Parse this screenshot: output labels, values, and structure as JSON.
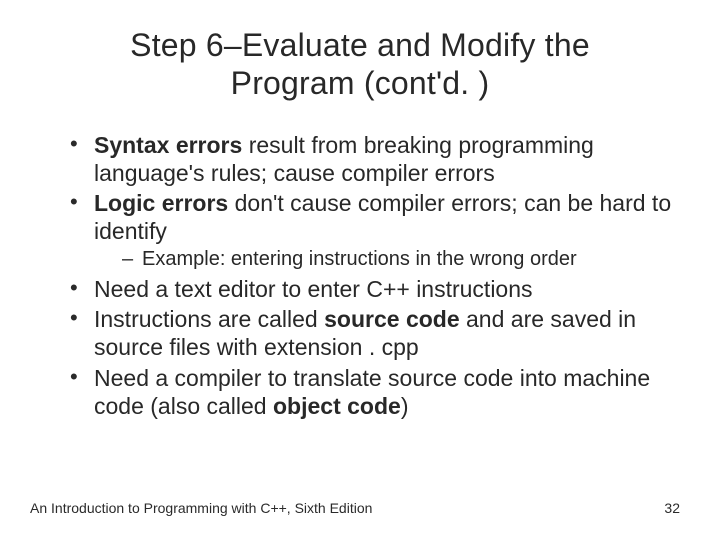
{
  "title": "Step 6–Evaluate and Modify the Program (cont'd. )",
  "bullets": {
    "b1_bold": "Syntax errors",
    "b1_rest": " result from breaking programming language's rules; cause compiler errors",
    "b2_bold": "Logic errors",
    "b2_rest": " don't cause compiler errors; can be hard to identify",
    "b2_sub": "Example: entering instructions in the wrong order",
    "b3": "Need a text editor to enter C++ instructions",
    "b4_pre": "Instructions are called ",
    "b4_bold": "source code",
    "b4_post": " and are saved in source files with extension . cpp",
    "b5_pre": "Need a compiler to translate source code into machine code (also called ",
    "b5_bold": "object code",
    "b5_post": ")"
  },
  "footer_left": "An Introduction to Programming with C++, Sixth Edition",
  "footer_right": "32"
}
